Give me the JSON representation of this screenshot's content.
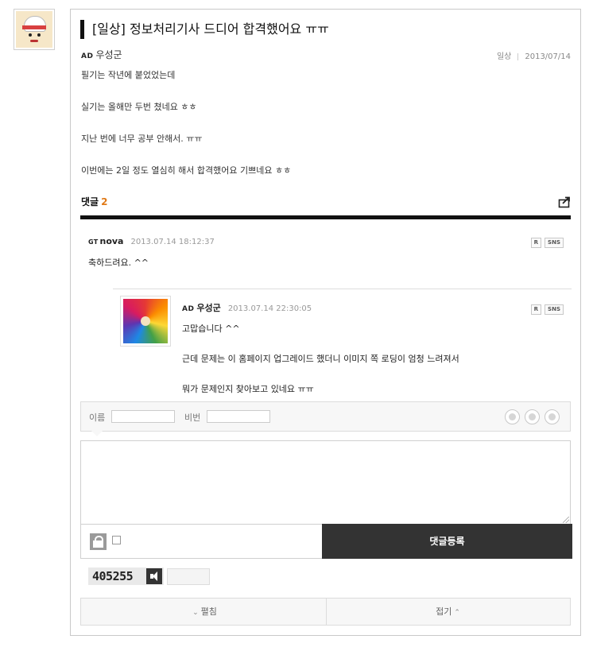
{
  "post": {
    "title": "[일상] 정보처리기사 드디어 합격했어요 ㅠㅠ",
    "author_badge": "AD",
    "author": "우성군",
    "category": "일상",
    "date": "2013/07/14",
    "body": [
      "필기는 작년에 붙었었는데",
      "실기는 올해만 두번 쳤네요 ㅎㅎ",
      "지난 번에 너무 공부 안해서. ㅠㅠ",
      "이번에는 2일 정도 열심히 해서 합격했어요 기쁘네요 ㅎㅎ"
    ]
  },
  "comments_header": {
    "label": "댓글",
    "count": "2"
  },
  "comments": [
    {
      "badge": "GT",
      "name": "nova",
      "date": "2013.07.14 18:12:37",
      "btn_r": "R",
      "btn_sns": "SNS",
      "text": "축하드려요. ^^"
    }
  ],
  "reply": {
    "badge": "AD",
    "name": "우성군",
    "date": "2013.07.14 22:30:05",
    "btn_r": "R",
    "btn_sns": "SNS",
    "lines": [
      "고맙습니다 ^^",
      "근데 문제는 이 홈페이지 업그레이드 했더니 이미지 쪽 로딩이 엄청 느려져서",
      "뭐가 문제인지 찾아보고 있네요 ㅠㅠ"
    ]
  },
  "form": {
    "name_label": "이름",
    "name_value": "",
    "password_label": "비번",
    "password_value": "",
    "textarea_value": "",
    "submit_label": "댓글등록",
    "captcha": "405255",
    "captcha_input": ""
  },
  "footer": {
    "expand_label": "펼침",
    "collapse_label": "접기"
  },
  "icons": {
    "share": "share-icon",
    "lock": "lock-icon",
    "speaker": "speaker-icon"
  },
  "colors": {
    "accent_count": "#e07a18",
    "submit_bg": "#333333",
    "title_bar": "#111111"
  }
}
